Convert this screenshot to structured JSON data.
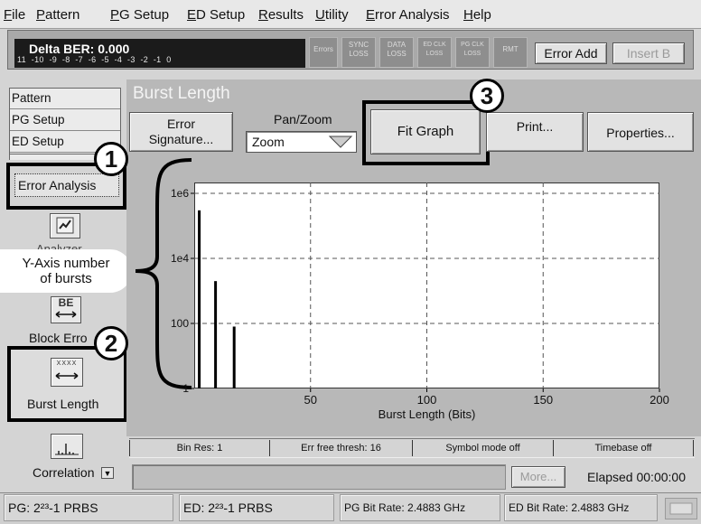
{
  "menu": {
    "items": [
      "File",
      "Pattern",
      "PG Setup",
      "ED Setup",
      "Results",
      "Utility",
      "Error Analysis",
      "Help"
    ]
  },
  "status_bar": {
    "ber_title": "Delta BER: 0.000",
    "ber_scale": [
      "11",
      "-10",
      "-9",
      "-8",
      "-7",
      "-6",
      "-5",
      "-4",
      "-3",
      "-2",
      "-1",
      "0"
    ],
    "indicators": {
      "errors": "Errors",
      "sync": [
        "SYNC",
        "LOSS"
      ],
      "data": [
        "DATA",
        "LOSS"
      ],
      "ed_clk": [
        "ED CLK",
        "LOSS"
      ],
      "pg_clk": [
        "PG CLK",
        "LOSS"
      ],
      "rmt": "RMT"
    },
    "error_add_label": "Error Add",
    "insert_label": "Insert B"
  },
  "nav": {
    "list_items": [
      "Pattern",
      "PG Setup",
      "ED Setup"
    ],
    "selected_item": "Error Analysis",
    "analyzer_partial": "Analyzer",
    "block_errors_label": "Block Erro",
    "block_errors_icon_text": "BE",
    "burst_length_label": "Burst Length",
    "burst_icon_text": "XXXX",
    "correlation_label": "Correlation"
  },
  "panel": {
    "title": "Burst Length",
    "error_signature_label": [
      "Error",
      "Signature..."
    ],
    "panzoom_label": "Pan/Zoom",
    "panzoom_value": "Zoom",
    "fit_graph_label": "Fit Graph",
    "print_label": "Print...",
    "properties_label": "Properties..."
  },
  "annotations": {
    "callout_1": "1",
    "callout_2": "2",
    "callout_3": "3",
    "y_axis_note": [
      "Y-Axis number",
      "of bursts"
    ]
  },
  "chart_data": {
    "type": "bar",
    "xlabel": "Burst Length (Bits)",
    "ylabel": "",
    "x_ticks": [
      "50",
      "100",
      "150",
      "200"
    ],
    "y_ticks": [
      "1",
      "100",
      "1e4",
      "1e6"
    ],
    "xlim": [
      0,
      200
    ],
    "ylim_log10": [
      0,
      6
    ],
    "y_scale": "log",
    "grid": true,
    "bars": [
      {
        "x": 1,
        "y": 300000
      },
      {
        "x": 8,
        "y": 2000
      },
      {
        "x": 16,
        "y": 80
      }
    ]
  },
  "footer": {
    "bin_res": "Bin Res: 1",
    "err_free": "Err free thresh: 16",
    "symbol_mode": "Symbol mode off",
    "timebase": "Timebase off",
    "more_label": "More...",
    "elapsed": "Elapsed 00:00:00"
  },
  "statusline": {
    "pg_pattern": "PG: 2²³-1 PRBS",
    "ed_pattern": "ED: 2²³-1 PRBS",
    "pg_rate": "PG Bit Rate: 2.4883 GHz",
    "ed_rate": "ED Bit Rate: 2.4883 GHz"
  }
}
